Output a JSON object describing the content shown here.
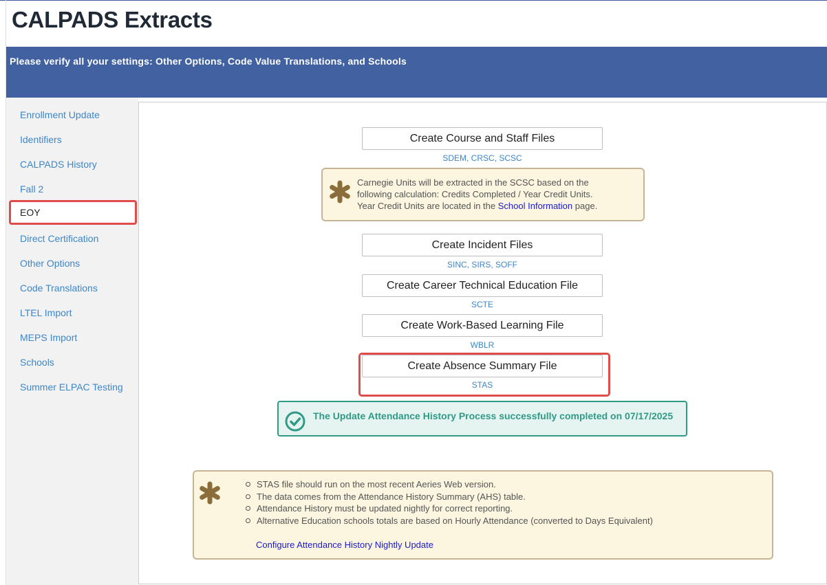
{
  "page": {
    "title": "CALPADS Extracts",
    "banner": "Please verify all your settings: Other Options, Code Value Translations, and Schools"
  },
  "sidebar": {
    "items": [
      {
        "label": "Enrollment Update"
      },
      {
        "label": "Identifiers"
      },
      {
        "label": "CALPADS History"
      },
      {
        "label": "Fall 2"
      },
      {
        "label": "EOY",
        "active": true
      },
      {
        "label": "Direct Certification"
      },
      {
        "label": "Other Options"
      },
      {
        "label": "Code Translations"
      },
      {
        "label": "LTEL Import"
      },
      {
        "label": "MEPS Import"
      },
      {
        "label": "Schools"
      },
      {
        "label": "Summer ELPAC Testing"
      }
    ]
  },
  "extracts": [
    {
      "button": "Create Course and Staff Files",
      "codes": "SDEM, CRSC, SCSC"
    },
    {
      "button": "Create Incident Files",
      "codes": "SINC, SIRS, SOFF"
    },
    {
      "button": "Create Career Technical Education File",
      "codes": "SCTE"
    },
    {
      "button": "Create Work-Based Learning File",
      "codes": "WBLR"
    },
    {
      "button": "Create Absence Summary File",
      "codes": "STAS"
    }
  ],
  "carnegie_note": {
    "line1": "Carnegie Units will be extracted in the SCSC based on the",
    "line2": "following calculation: Credits Completed / Year Credit Units.",
    "line3_prefix": "Year Credit Units are located in the ",
    "line3_link": "School Information",
    "line3_suffix": " page."
  },
  "success": {
    "message": "The Update Attendance History Process successfully completed on 07/17/2025"
  },
  "stas_note": {
    "bullets": [
      "STAS file should run on the most recent Aeries Web version.",
      "The data comes from the Attendance History Summary (AHS) table.",
      "Attendance History must be updated nightly for correct reporting.",
      "Alternative Education schools totals are based on Hourly Attendance (converted to Days Equivalent)"
    ],
    "link": "Configure Attendance History Nightly Update"
  },
  "colors": {
    "banner": "#4161a1",
    "link": "#3d86c8",
    "highlight": "#e04b4b",
    "success": "#2f9a86",
    "note_bg": "#fcf5e0",
    "star": "#8a6d3b"
  }
}
